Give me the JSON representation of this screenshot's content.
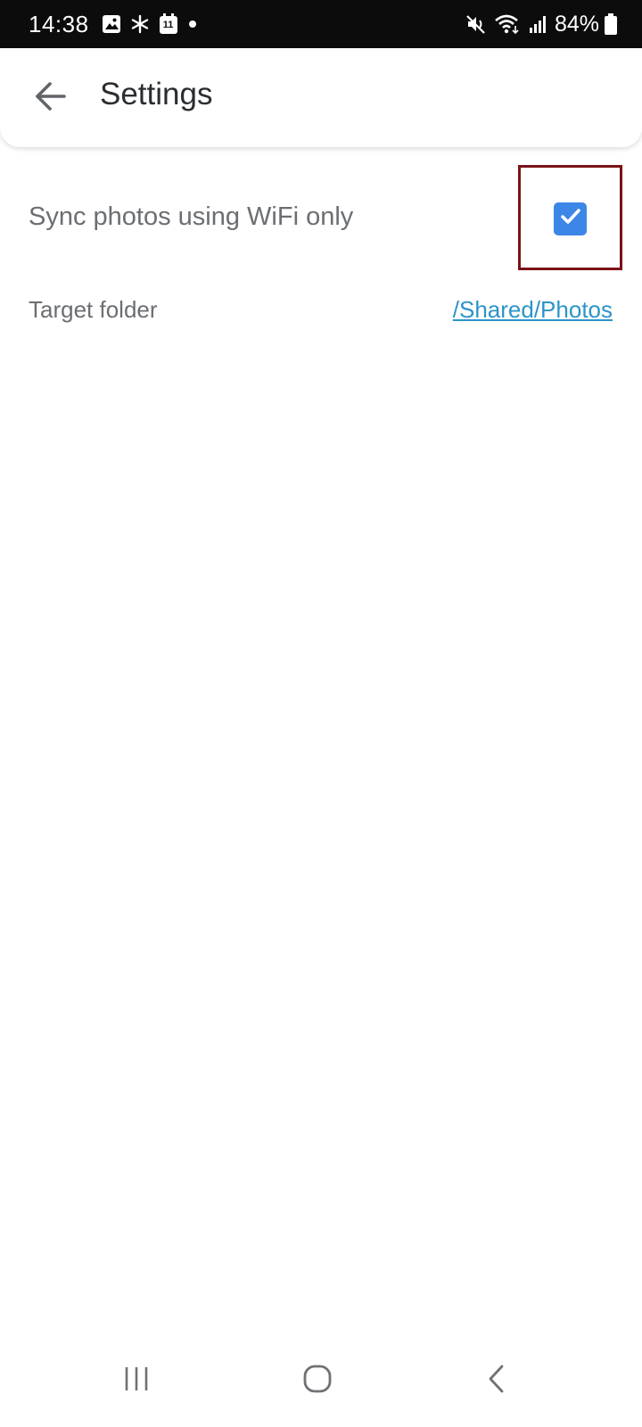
{
  "status_bar": {
    "time": "14:38",
    "calendar_day": "11",
    "battery_percent": "84%",
    "icons_left": [
      "image-icon",
      "asterisk-icon",
      "calendar-icon",
      "dot-icon"
    ],
    "icons_right": [
      "mute-icon",
      "wifi-icon",
      "signal-icon",
      "battery-icon"
    ]
  },
  "app_bar": {
    "title": "Settings",
    "back_icon": "arrow-left-icon"
  },
  "settings": {
    "sync_wifi": {
      "label": "Sync photos using WiFi only",
      "checked": true
    },
    "target_folder": {
      "label": "Target folder",
      "value": "/Shared/Photos"
    }
  },
  "nav_bar": {
    "buttons": [
      "recents-icon",
      "home-icon",
      "back-icon"
    ]
  },
  "colors": {
    "checkbox": "#3b86e6",
    "link": "#2b94c9",
    "highlight_border": "#7a1216",
    "status_bar_bg": "#0c0c0c"
  }
}
